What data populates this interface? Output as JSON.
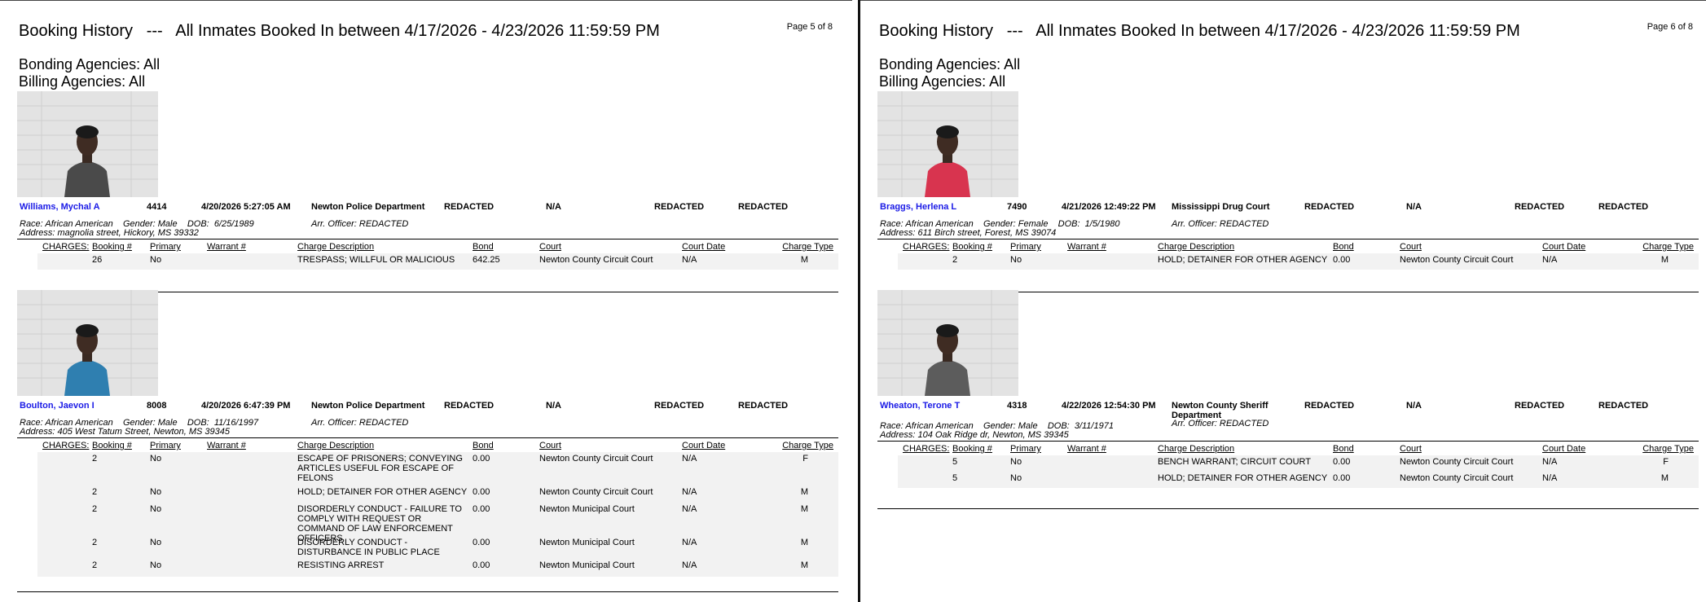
{
  "pages": [
    {
      "title": "Booking History   ---   All Inmates Booked In between 4/17/2026 - 4/23/2026 11:59:59 PM",
      "page_number": "Page 5 of 8",
      "bonding": "Bonding Agencies: All",
      "billing": "Billing Agencies: All",
      "records": [
        {
          "name": "Williams, Mychal A",
          "booking_number": "4414",
          "booking_date": "4/20/2026 5:27:05 AM",
          "agency": "Newton Police Department",
          "col1": "REDACTED",
          "col2": "N/A",
          "col3": "REDACTED",
          "col4": "REDACTED",
          "demographics": "Race: African American    Gender: Male    DOB:  6/25/1989",
          "officer": "Arr. Officer: REDACTED",
          "address": "Address: magnolia street, Hickory, MS 39332",
          "photo": {
            "shirt_color": "#4a4a4a"
          },
          "charges": [
            {
              "booking": "26",
              "primary": "No",
              "warrant": "",
              "desc": "TRESPASS; WILLFUL OR MALICIOUS",
              "bond": "642.25",
              "court": "Newton County Circuit Court",
              "court_date": "N/A",
              "type": "M"
            }
          ]
        },
        {
          "name": "Boulton, Jaevon I",
          "booking_number": "8008",
          "booking_date": "4/20/2026 6:47:39 PM",
          "agency": "Newton Police Department",
          "col1": "REDACTED",
          "col2": "N/A",
          "col3": "REDACTED",
          "col4": "REDACTED",
          "demographics": "Race: African American    Gender: Male    DOB:  11/16/1997",
          "officer": "Arr. Officer: REDACTED",
          "address": "Address: 405 West Tatum Street, Newton, MS 39345",
          "photo": {
            "shirt_color": "#2f7fb0"
          },
          "charges": [
            {
              "booking": "2",
              "primary": "No",
              "warrant": "",
              "desc": "ESCAPE OF PRISONERS; CONVEYING ARTICLES USEFUL FOR  ESCAPE OF FELONS",
              "bond": "0.00",
              "court": "Newton County Circuit Court",
              "court_date": "N/A",
              "type": "F"
            },
            {
              "booking": "2",
              "primary": "No",
              "warrant": "",
              "desc": "HOLD; DETAINER FOR OTHER AGENCY",
              "bond": "0.00",
              "court": "Newton County Circuit Court",
              "court_date": "N/A",
              "type": "M"
            },
            {
              "booking": "2",
              "primary": "No",
              "warrant": "",
              "desc": "DISORDERLY CONDUCT - FAILURE TO COMPLY WITH REQUEST OR COMMAND OF LAW ENFORCEMENT OFFICERS",
              "bond": "0.00",
              "court": "Newton Municipal Court",
              "court_date": "N/A",
              "type": "M"
            },
            {
              "booking": "2",
              "primary": "No",
              "warrant": "",
              "desc": "DISORDERLY CONDUCT - DISTURBANCE IN PUBLIC PLACE",
              "bond": "0.00",
              "court": "Newton Municipal Court",
              "court_date": "N/A",
              "type": "M"
            },
            {
              "booking": "2",
              "primary": "No",
              "warrant": "",
              "desc": "RESISTING ARREST",
              "bond": "0.00",
              "court": "Newton Municipal Court",
              "court_date": "N/A",
              "type": "M"
            }
          ]
        }
      ]
    },
    {
      "title": "Booking History   ---   All Inmates Booked In between 4/17/2026 - 4/23/2026 11:59:59 PM",
      "page_number": "Page 6 of 8",
      "bonding": "Bonding Agencies: All",
      "billing": "Billing Agencies: All",
      "records": [
        {
          "name": "Braggs, Herlena L",
          "booking_number": "7490",
          "booking_date": "4/21/2026 12:49:22 PM",
          "agency": "Mississippi Drug Court",
          "col1": "REDACTED",
          "col2": "N/A",
          "col3": "REDACTED",
          "col4": "REDACTED",
          "demographics": "Race: African American    Gender: Female    DOB:  1/5/1980",
          "officer": "Arr. Officer: REDACTED",
          "address": "Address: 611 Birch street, Forest, MS 39074",
          "photo": {
            "shirt_color": "#d8344f"
          },
          "charges": [
            {
              "booking": "2",
              "primary": "No",
              "warrant": "",
              "desc": "HOLD; DETAINER FOR OTHER AGENCY",
              "bond": "0.00",
              "court": "Newton County Circuit Court",
              "court_date": "N/A",
              "type": "M"
            }
          ]
        },
        {
          "name": "Wheaton, Terone T",
          "booking_number": "4318",
          "booking_date": "4/22/2026 12:54:30 PM",
          "agency": "Newton County Sheriff Department",
          "col1": "REDACTED",
          "col2": "N/A",
          "col3": "REDACTED",
          "col4": "REDACTED",
          "demographics": "Race: African American    Gender: Male    DOB:  3/11/1971",
          "officer": "Arr. Officer: REDACTED",
          "address": "Address: 104 Oak Ridge dr, Newton, MS 39345",
          "photo": {
            "shirt_color": "#5c5c5c"
          },
          "charges": [
            {
              "booking": "5",
              "primary": "No",
              "warrant": "",
              "desc": "BENCH WARRANT;  CIRCUIT COURT",
              "bond": "0.00",
              "court": "Newton County Circuit Court",
              "court_date": "N/A",
              "type": "F"
            },
            {
              "booking": "5",
              "primary": "No",
              "warrant": "",
              "desc": "HOLD; DETAINER FOR OTHER AGENCY",
              "bond": "0.00",
              "court": "Newton County Circuit Court",
              "court_date": "N/A",
              "type": "M"
            }
          ]
        }
      ]
    }
  ],
  "charge_headers": {
    "label": "CHARGES:",
    "booking": "Booking #",
    "primary": "Primary",
    "warrant": "Warrant #",
    "desc": "Charge Description",
    "bond": "Bond",
    "court": "Court",
    "court_date": "Court Date",
    "type": "Charge Type"
  }
}
